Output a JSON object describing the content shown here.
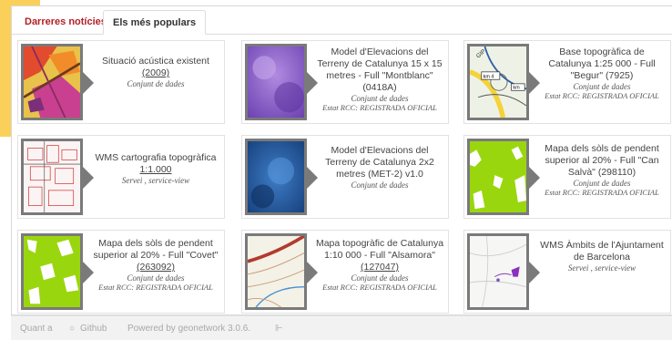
{
  "tabs": {
    "recent": "Darreres notícies",
    "popular": "Els més populars"
  },
  "cards": [
    {
      "title": "Situació acústica existent",
      "code": "(2009)",
      "kind": "Conjunt de dades",
      "status": ""
    },
    {
      "title": "Model d'Elevacions del Terreny de Catalunya 15 x 15 metres - Full \"Montblanc\" (0418A)",
      "code": "",
      "kind": "Conjunt de dades",
      "status": "Estat RCC: REGISTRADA OFICIAL"
    },
    {
      "title": "Base topogràfica de Catalunya 1:25 000 - Full \"Begur\" (7925)",
      "code": "",
      "kind": "Conjunt de dades",
      "status": "Estat RCC: REGISTRADA OFICIAL"
    },
    {
      "title": "WMS cartografia topogràfica",
      "code": "1:1.000",
      "kind": "Servei , service-view",
      "status": ""
    },
    {
      "title": "Model d'Elevacions del Terreny de Catalunya 2x2 metres (MET-2) v1.0",
      "code": "",
      "kind": "Conjunt de dades",
      "status": ""
    },
    {
      "title": "Mapa dels sòls de pendent superior al 20% - Full \"Can Salvà\" (298110)",
      "code": "",
      "kind": "Conjunt de dades",
      "status": "Estat RCC: REGISTRADA OFICIAL"
    },
    {
      "title": "Mapa dels sòls de pendent superior al 20% - Full \"Covet\"",
      "code": "(263092)",
      "kind": "Conjunt de dades",
      "status": "Estat RCC: REGISTRADA OFICIAL"
    },
    {
      "title": "Mapa topogràfic de Catalunya 1:10 000 - Full \"Alsamora\"",
      "code": "(127047)",
      "kind": "Conjunt de dades",
      "status": "Estat RCC: REGISTRADA OFICIAL"
    },
    {
      "title": "WMS Àmbits de l'Ajuntament de Barcelona",
      "code": "",
      "kind": "Servei , service-view",
      "status": ""
    }
  ],
  "map_labels": {
    "road_label": "GIP",
    "km_a": "km 4",
    "km_b": "km"
  },
  "footer": {
    "about": "Quant a",
    "github": "Github",
    "powered": "Powered by geonetwork 3.0.6."
  },
  "icons": {
    "github": "github-icon",
    "rss": "rss-icon",
    "arrow": "thumbnail-arrow-icon"
  },
  "colors": {
    "accent": "#b32025",
    "corner": "#fbd05a",
    "thumb_border": "#7a7a7a",
    "slope_green": "#9ad60e",
    "dem_purple": "#8a63c8",
    "dem_blue": "#1d4f92"
  }
}
